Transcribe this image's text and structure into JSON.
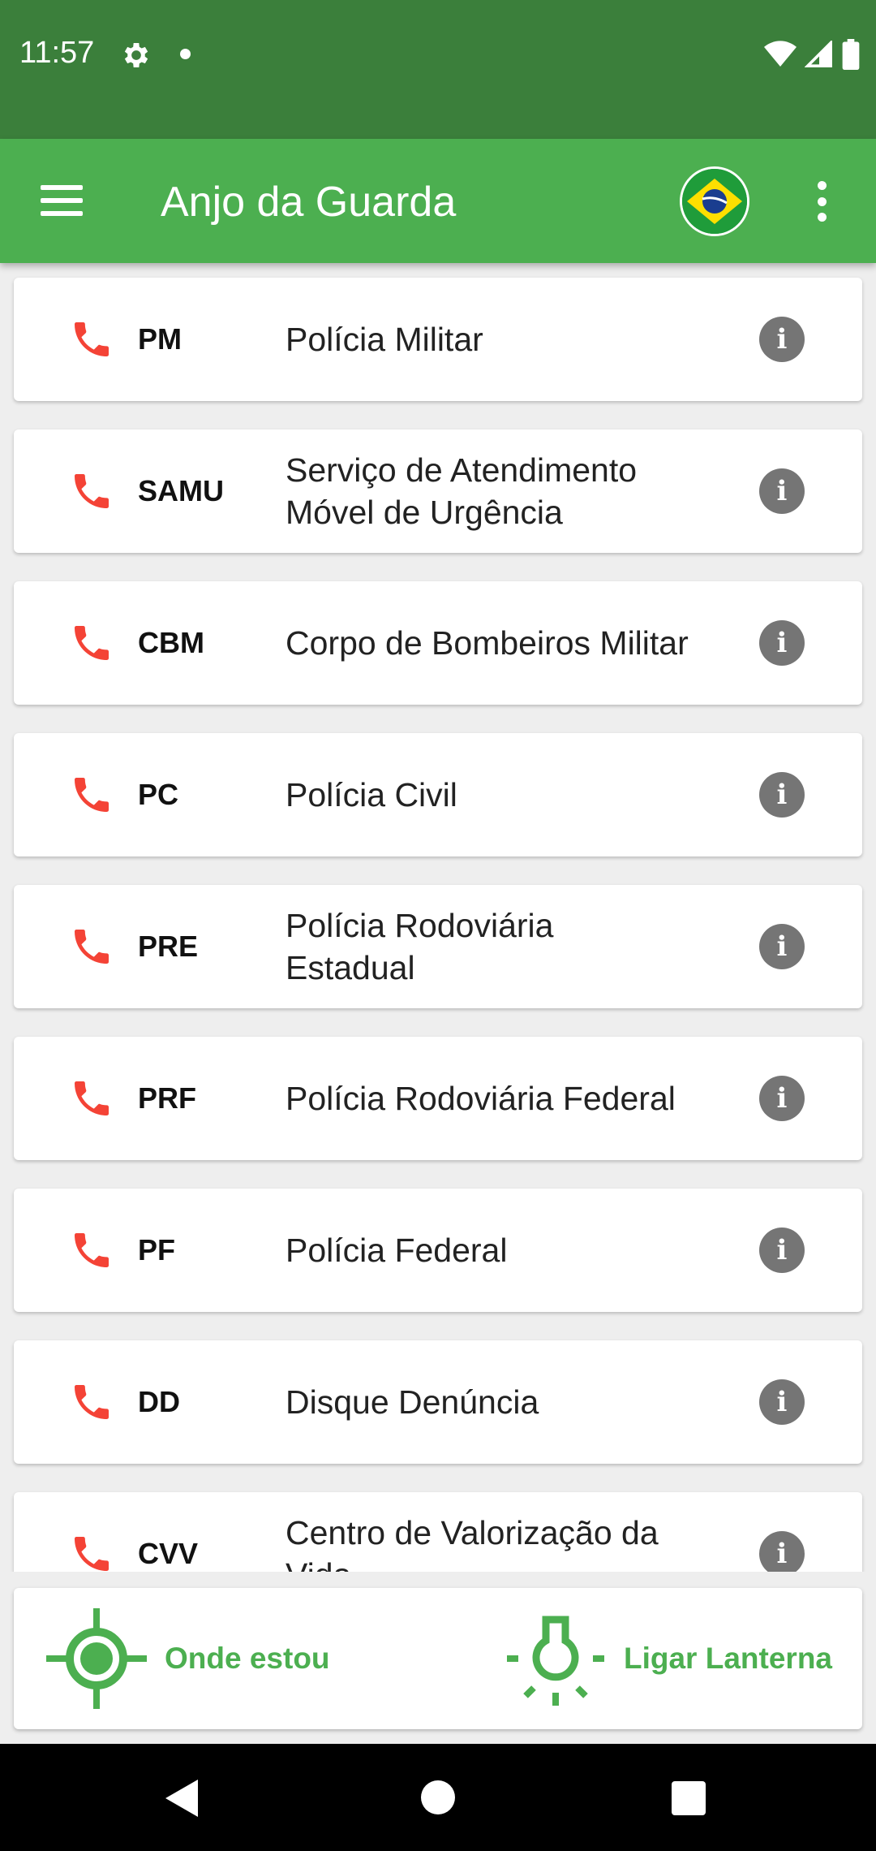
{
  "status_bar": {
    "time": "11:57",
    "icons": [
      "gear-icon",
      "notification-dot-icon",
      "wifi-icon",
      "signal-icon",
      "battery-icon"
    ]
  },
  "app_bar": {
    "title": "Anjo da Guarda",
    "menu_icon": "hamburger-menu-icon",
    "flag": "brazil-flag-icon",
    "overflow_icon": "more-vert-icon"
  },
  "colors": {
    "primary": "#4caf50",
    "primary_dark": "#3b7f3b",
    "phone_icon": "#f44336",
    "info_icon": "#757575"
  },
  "contacts": [
    {
      "abbr": "PM",
      "name": "Polícia Militar"
    },
    {
      "abbr": "SAMU",
      "name": "Serviço de Atendimento Móvel de Urgência"
    },
    {
      "abbr": "CBM",
      "name": "Corpo de Bombeiros Militar"
    },
    {
      "abbr": "PC",
      "name": "Polícia Civil"
    },
    {
      "abbr": "PRE",
      "name": "Polícia Rodoviária Estadual"
    },
    {
      "abbr": "PRF",
      "name": "Polícia Rodoviária Federal"
    },
    {
      "abbr": "PF",
      "name": "Polícia Federal"
    },
    {
      "abbr": "DD",
      "name": "Disque Denúncia"
    },
    {
      "abbr": "CVV",
      "name": "Centro de Valorização da Vida"
    }
  ],
  "bottom_actions": {
    "where": "Onde estou",
    "torch": "Ligar Lanterna"
  },
  "nav_bar": {
    "icons": [
      "back-icon",
      "home-icon",
      "recents-icon"
    ]
  }
}
